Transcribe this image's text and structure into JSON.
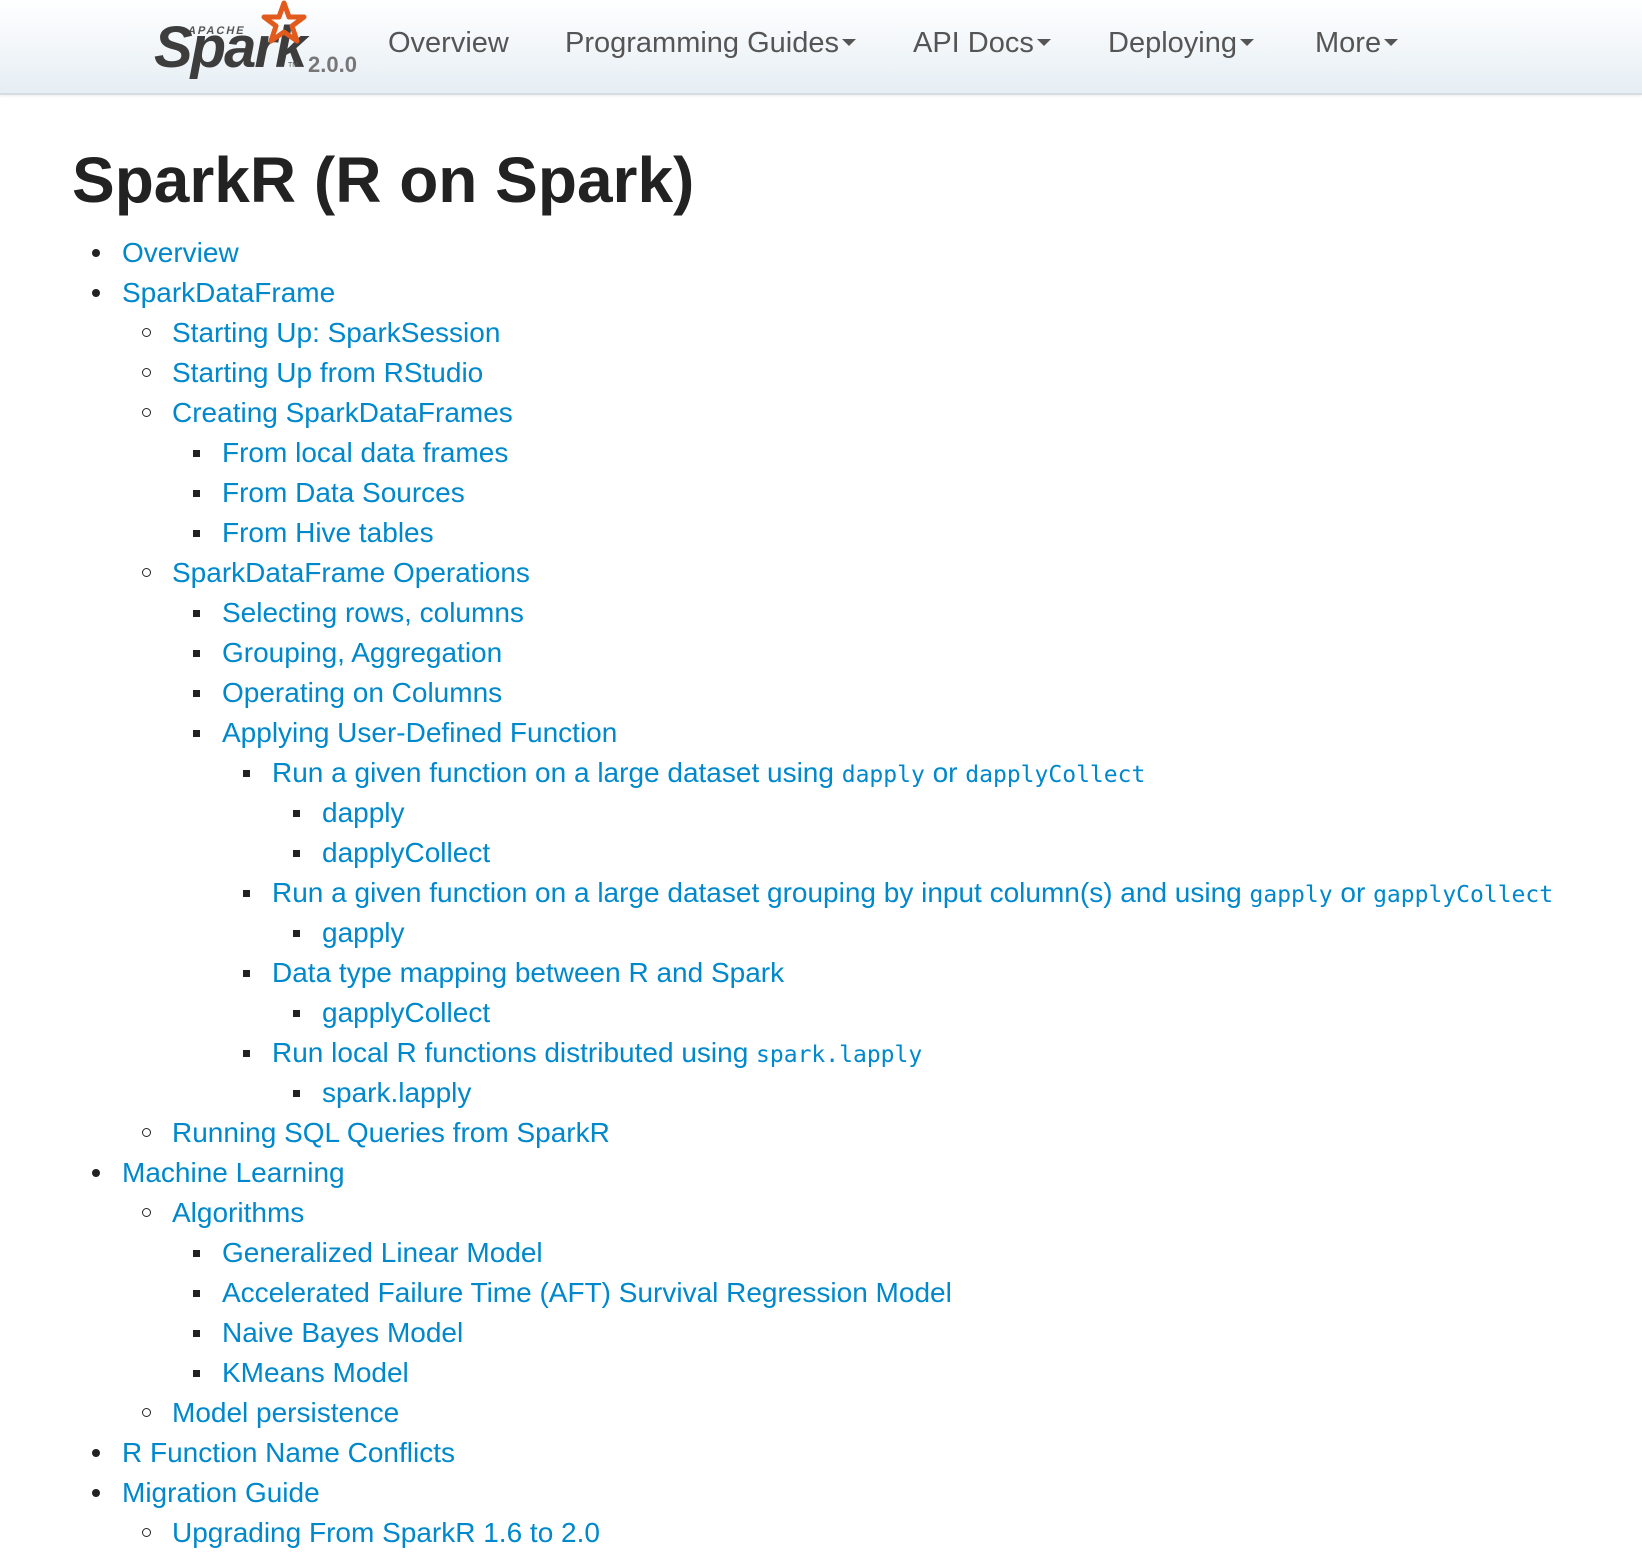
{
  "navbar": {
    "brand": {
      "apache": "APACHE",
      "spark": "Spark",
      "tm": "TM",
      "version": "2.0.0"
    },
    "items": [
      {
        "label": "Overview",
        "has_dropdown": false
      },
      {
        "label": "Programming Guides",
        "has_dropdown": true
      },
      {
        "label": "API Docs",
        "has_dropdown": true
      },
      {
        "label": "Deploying",
        "has_dropdown": true
      },
      {
        "label": "More",
        "has_dropdown": true
      }
    ]
  },
  "page": {
    "title": "SparkR (R on Spark)"
  },
  "toc": [
    {
      "level": 1,
      "parts": [
        {
          "text": "Overview"
        }
      ]
    },
    {
      "level": 1,
      "parts": [
        {
          "text": "SparkDataFrame"
        }
      ]
    },
    {
      "level": 2,
      "parts": [
        {
          "text": "Starting Up: SparkSession"
        }
      ]
    },
    {
      "level": 2,
      "parts": [
        {
          "text": "Starting Up from RStudio"
        }
      ]
    },
    {
      "level": 2,
      "parts": [
        {
          "text": "Creating SparkDataFrames"
        }
      ]
    },
    {
      "level": 3,
      "parts": [
        {
          "text": "From local data frames"
        }
      ]
    },
    {
      "level": 3,
      "parts": [
        {
          "text": "From Data Sources"
        }
      ]
    },
    {
      "level": 3,
      "parts": [
        {
          "text": "From Hive tables"
        }
      ]
    },
    {
      "level": 2,
      "parts": [
        {
          "text": "SparkDataFrame Operations"
        }
      ]
    },
    {
      "level": 3,
      "parts": [
        {
          "text": "Selecting rows, columns"
        }
      ]
    },
    {
      "level": 3,
      "parts": [
        {
          "text": "Grouping, Aggregation"
        }
      ]
    },
    {
      "level": 3,
      "parts": [
        {
          "text": "Operating on Columns"
        }
      ]
    },
    {
      "level": 3,
      "parts": [
        {
          "text": "Applying User-Defined Function"
        }
      ]
    },
    {
      "level": 4,
      "parts": [
        {
          "text": "Run a given function on a large dataset using "
        },
        {
          "text": "dapply",
          "code": true
        },
        {
          "text": " or "
        },
        {
          "text": "dapplyCollect",
          "code": true
        }
      ]
    },
    {
      "level": 5,
      "parts": [
        {
          "text": "dapply"
        }
      ]
    },
    {
      "level": 5,
      "parts": [
        {
          "text": "dapplyCollect"
        }
      ]
    },
    {
      "level": 4,
      "parts": [
        {
          "text": "Run a given function on a large dataset grouping by input column(s) and using "
        },
        {
          "text": "gapply",
          "code": true
        },
        {
          "text": " or "
        },
        {
          "text": "gapplyCollect",
          "code": true
        }
      ]
    },
    {
      "level": 5,
      "parts": [
        {
          "text": "gapply"
        }
      ]
    },
    {
      "level": 4,
      "parts": [
        {
          "text": "Data type mapping between R and Spark"
        }
      ]
    },
    {
      "level": 5,
      "parts": [
        {
          "text": "gapplyCollect"
        }
      ]
    },
    {
      "level": 4,
      "parts": [
        {
          "text": "Run local R functions distributed using "
        },
        {
          "text": "spark.lapply",
          "code": true
        }
      ]
    },
    {
      "level": 5,
      "parts": [
        {
          "text": "spark.lapply"
        }
      ]
    },
    {
      "level": 2,
      "parts": [
        {
          "text": "Running SQL Queries from SparkR"
        }
      ]
    },
    {
      "level": 1,
      "parts": [
        {
          "text": "Machine Learning"
        }
      ]
    },
    {
      "level": 2,
      "parts": [
        {
          "text": "Algorithms"
        }
      ]
    },
    {
      "level": 3,
      "parts": [
        {
          "text": "Generalized Linear Model"
        }
      ]
    },
    {
      "level": 3,
      "parts": [
        {
          "text": "Accelerated Failure Time (AFT) Survival Regression Model"
        }
      ]
    },
    {
      "level": 3,
      "parts": [
        {
          "text": "Naive Bayes Model"
        }
      ]
    },
    {
      "level": 3,
      "parts": [
        {
          "text": "KMeans Model"
        }
      ]
    },
    {
      "level": 2,
      "parts": [
        {
          "text": "Model persistence"
        }
      ]
    },
    {
      "level": 1,
      "parts": [
        {
          "text": "R Function Name Conflicts"
        }
      ]
    },
    {
      "level": 1,
      "parts": [
        {
          "text": "Migration Guide"
        }
      ]
    },
    {
      "level": 2,
      "parts": [
        {
          "text": "Upgrading From SparkR 1.6 to 2.0"
        }
      ]
    }
  ],
  "colors": {
    "link": "#0088cc",
    "title": "#222222",
    "nav_text": "#555555",
    "brand_star": "#e25a1c"
  }
}
